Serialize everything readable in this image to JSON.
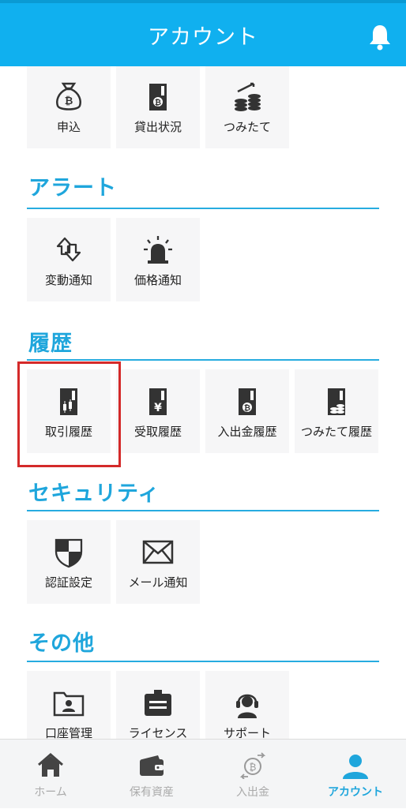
{
  "header": {
    "title": "アカウント"
  },
  "menu": {
    "top": [
      "申込",
      "貸出状況",
      "つみたて"
    ],
    "alert": {
      "title": "アラート",
      "items": [
        "変動通知",
        "価格通知"
      ]
    },
    "history": {
      "title": "履歴",
      "items": [
        "取引履歴",
        "受取履歴",
        "入出金履歴",
        "つみたて履歴"
      ]
    },
    "security": {
      "title": "セキュリティ",
      "items": [
        "認証設定",
        "メール通知"
      ]
    },
    "other": {
      "title": "その他",
      "items": [
        "口座管理",
        "ライセンス",
        "サポート"
      ]
    }
  },
  "tabs": [
    "ホーム",
    "保有資産",
    "入出金",
    "アカウント"
  ],
  "colors": {
    "accent": "#10b0ef",
    "highlight": "#d42a2a"
  }
}
